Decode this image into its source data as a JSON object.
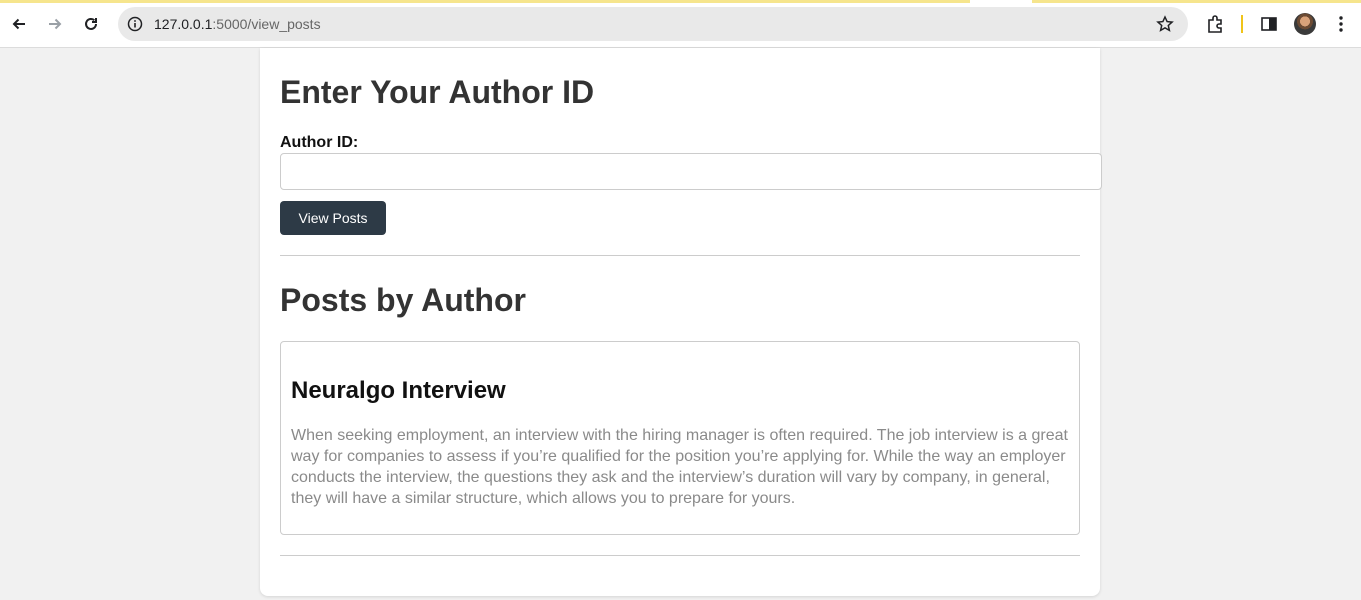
{
  "browser": {
    "url_host": "127.0.0.1",
    "url_path": ":5000/view_posts",
    "icons": [
      "back-arrow-icon",
      "forward-arrow-icon",
      "reload-icon",
      "site-info-icon",
      "bookmark-star-icon",
      "extensions-icon",
      "side-panel-icon",
      "profile-avatar",
      "more-menu-icon"
    ]
  },
  "form": {
    "heading": "Enter Your Author ID",
    "label": "Author ID:",
    "input_value": "",
    "submit_label": "View Posts"
  },
  "posts_section": {
    "heading": "Posts by Author",
    "posts": [
      {
        "title": "Neuralgo Interview",
        "content": "When seeking employment, an interview with the hiring manager is often required. The job interview is a great way for companies to assess if you’re qualified for the position you’re applying for. While the way an employer conducts the interview, the questions they ask and the interview’s duration will vary by company, in general, they will have a similar structure, which allows you to prepare for yours."
      }
    ]
  },
  "colors": {
    "page_background": "#f1f1f1",
    "button_background": "#2d3a46",
    "heading_text": "#333333",
    "post_text": "#8a8a8a"
  }
}
